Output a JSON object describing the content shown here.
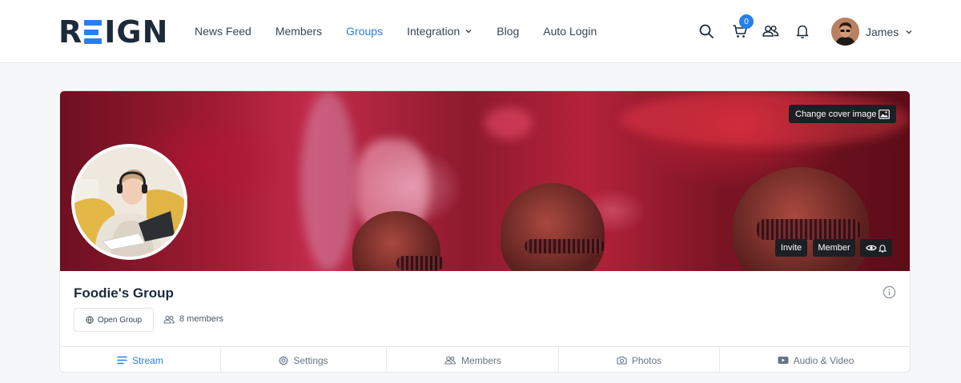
{
  "brand": {
    "logo_text_start": "R",
    "logo_text_end": "IGN",
    "accent": "#2680eb"
  },
  "nav": {
    "items": [
      {
        "label": "News Feed"
      },
      {
        "label": "Members"
      },
      {
        "label": "Groups",
        "active": true
      },
      {
        "label": "Integration",
        "has_dropdown": true
      },
      {
        "label": "Blog"
      },
      {
        "label": "Auto Login"
      }
    ]
  },
  "header_icons": {
    "search": "search-icon",
    "cart": "cart-icon",
    "cart_count": "0",
    "friends": "friends-icon",
    "notifications": "bell-icon"
  },
  "user": {
    "name": "James"
  },
  "group": {
    "change_cover_label": "Change cover image",
    "invite_label": "Invite",
    "member_label": "Member",
    "name": "Foodie's Group",
    "type_label": "Open Group",
    "members_label": "8 members"
  },
  "tabs": [
    {
      "label": "Stream",
      "icon": "list-icon",
      "active": true
    },
    {
      "label": "Settings",
      "icon": "gear-icon"
    },
    {
      "label": "Members",
      "icon": "users-icon"
    },
    {
      "label": "Photos",
      "icon": "camera-icon"
    },
    {
      "label": "Audio & Video",
      "icon": "video-icon"
    }
  ]
}
